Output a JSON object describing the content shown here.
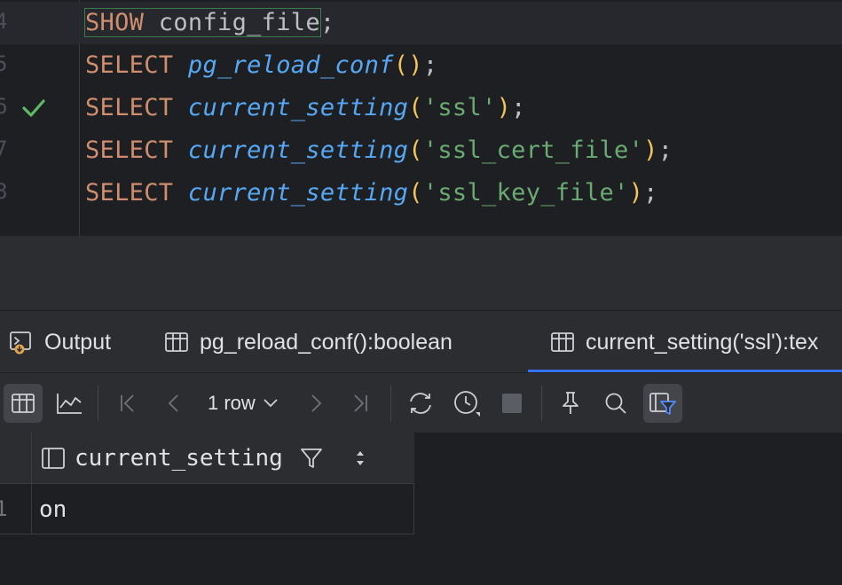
{
  "editor": {
    "lines": [
      {
        "no": "4",
        "tokens": {
          "kw": "SHOW",
          "rest": " config_file",
          "semi": ";"
        }
      },
      {
        "no": "5",
        "tokens": {
          "kw": "SELECT",
          "fn": "pg_reload_conf",
          "open": "(",
          "close": ")",
          "semi": ";"
        }
      },
      {
        "no": "6",
        "tokens": {
          "kw": "SELECT",
          "fn": "current_setting",
          "open": "(",
          "str": "'ssl'",
          "close": ")",
          "semi": ";"
        }
      },
      {
        "no": "7",
        "tokens": {
          "kw": "SELECT",
          "fn": "current_setting",
          "open": "(",
          "str": "'ssl_cert_file'",
          "close": ")",
          "semi": ";"
        }
      },
      {
        "no": "8",
        "tokens": {
          "kw": "SELECT",
          "fn": "current_setting",
          "open": "(",
          "str": "'ssl_key_file'",
          "close": ")",
          "semi": ";"
        }
      }
    ]
  },
  "tabs": [
    {
      "label": "Output",
      "icon": "output-console-icon"
    },
    {
      "label": "pg_reload_conf():boolean",
      "icon": "table-icon"
    },
    {
      "label": "current_setting('ssl'):tex",
      "icon": "table-icon"
    }
  ],
  "toolbar": {
    "rows_label": "1 row"
  },
  "grid": {
    "column": "current_setting",
    "rows": [
      {
        "num": "1",
        "value": "on"
      }
    ]
  },
  "colors": {
    "keyword": "#cf8e6d",
    "function": "#56a8f5",
    "string": "#6aab73",
    "paren": "#f2c55c",
    "success": "#5fb865",
    "accent": "#3574f0"
  }
}
